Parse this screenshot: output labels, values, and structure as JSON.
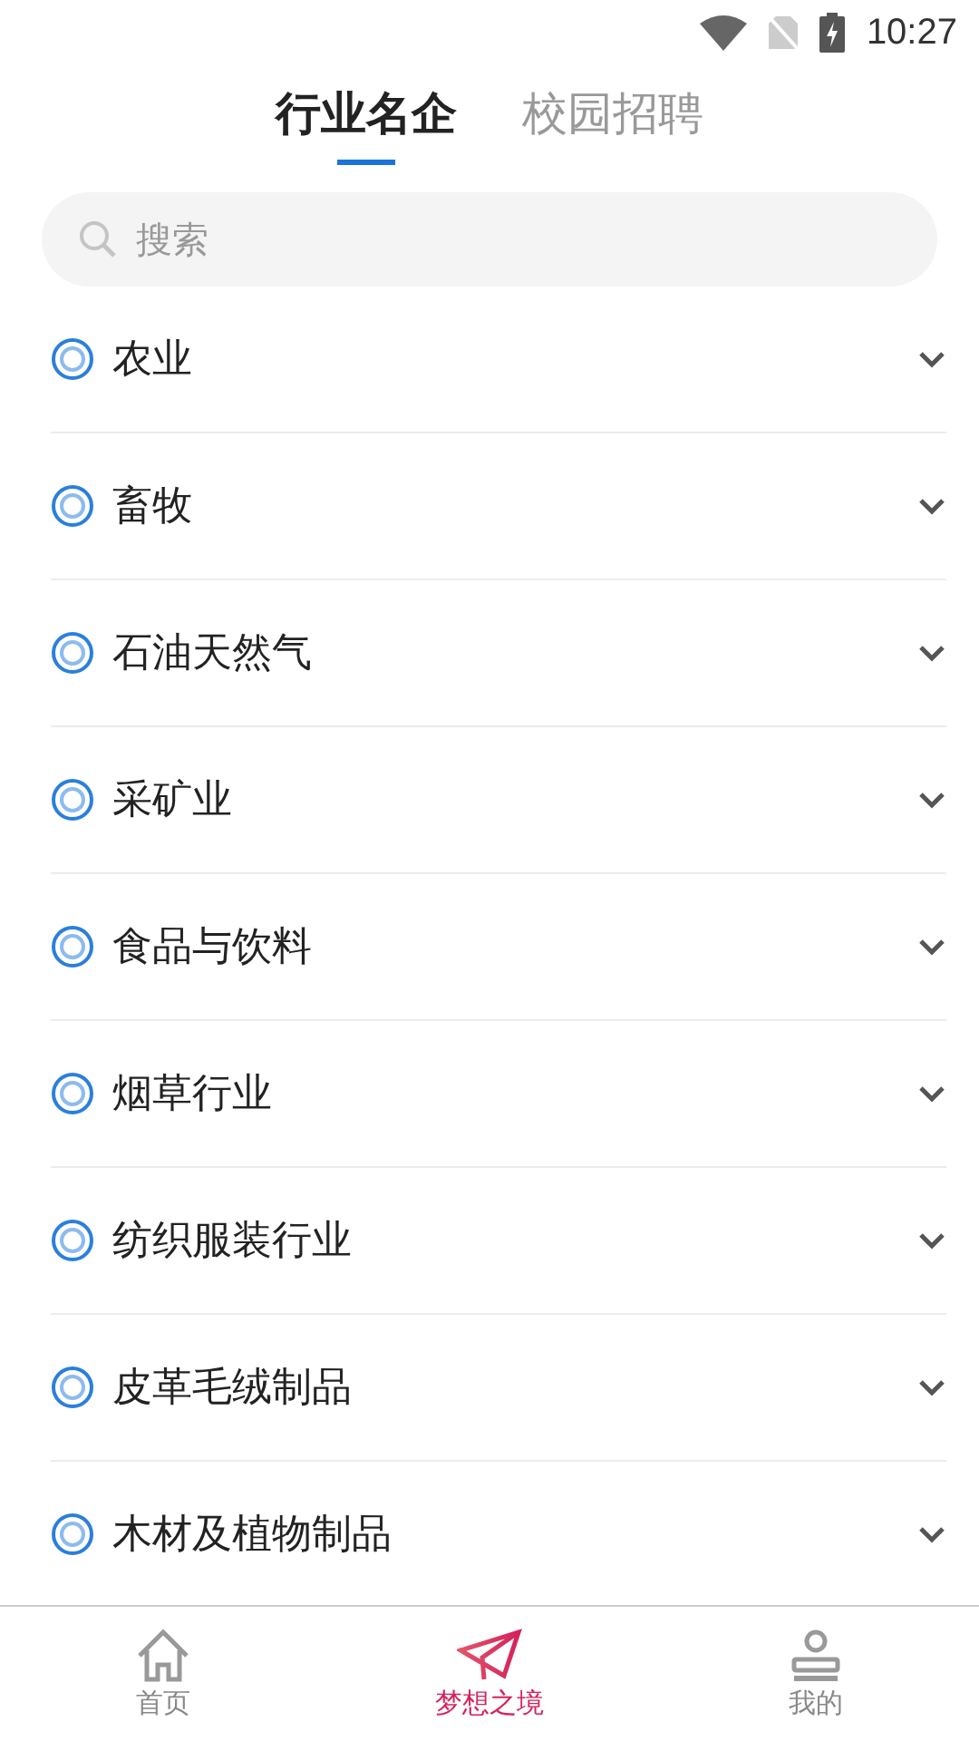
{
  "status_bar": {
    "time": "10:27"
  },
  "tabs": [
    {
      "label": "行业名企",
      "selected": true
    },
    {
      "label": "校园招聘",
      "selected": false
    }
  ],
  "search": {
    "placeholder": "搜索"
  },
  "categories": [
    {
      "label": "农业",
      "expanded": false
    },
    {
      "label": "畜牧",
      "expanded": false
    },
    {
      "label": "石油天然气",
      "expanded": false
    },
    {
      "label": "采矿业",
      "expanded": false
    },
    {
      "label": "食品与饮料",
      "expanded": false
    },
    {
      "label": "烟草行业",
      "expanded": false
    },
    {
      "label": "纺织服装行业",
      "expanded": false
    },
    {
      "label": "皮革毛绒制品",
      "expanded": false
    },
    {
      "label": "木材及植物制品",
      "expanded": false
    }
  ],
  "bottom_nav": [
    {
      "kind": "home",
      "label": "首页",
      "selected": false
    },
    {
      "kind": "plane",
      "label": "梦想之境",
      "selected": true
    },
    {
      "kind": "profile",
      "label": "我的",
      "selected": false
    }
  ]
}
